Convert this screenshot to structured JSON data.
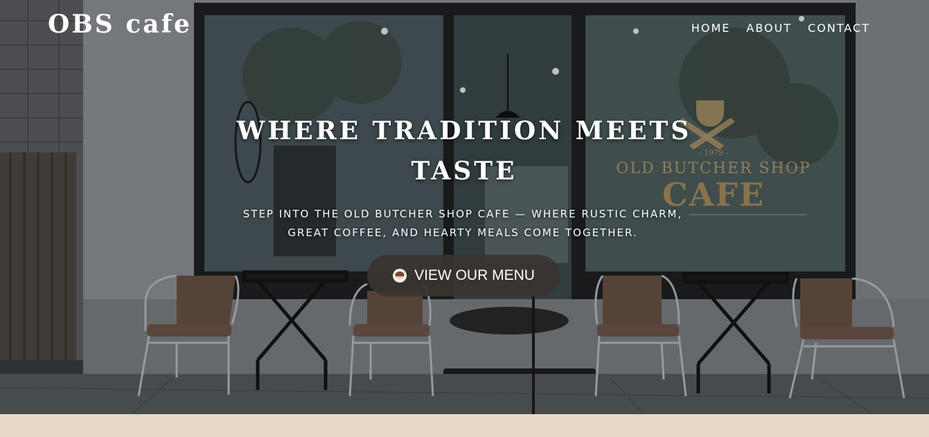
{
  "nav": {
    "brand": "OBS cafe",
    "links": [
      {
        "label": "HOME"
      },
      {
        "label": "ABOUT"
      },
      {
        "label": "CONTACT"
      }
    ]
  },
  "hero": {
    "headline": "WHERE TRADITION MEETS TASTE",
    "subtitle": "STEP INTO THE OLD BUTCHER SHOP CAFE — WHERE RUSTIC CHARM, GREAT COFFEE, AND HEARTY MEALS COME TOGETHER.",
    "cta_label": "VIEW OUR MENU",
    "cta_icon": "coffee-cup-icon",
    "window_sign": {
      "year": "- 1979 -",
      "line1": "OLD BUTCHER SHOP",
      "line2": "CAFE"
    }
  },
  "colors": {
    "footer_band": "#e6d9c8",
    "cta_bg": "#3a3430",
    "sign_gold": "#b49a6a"
  }
}
